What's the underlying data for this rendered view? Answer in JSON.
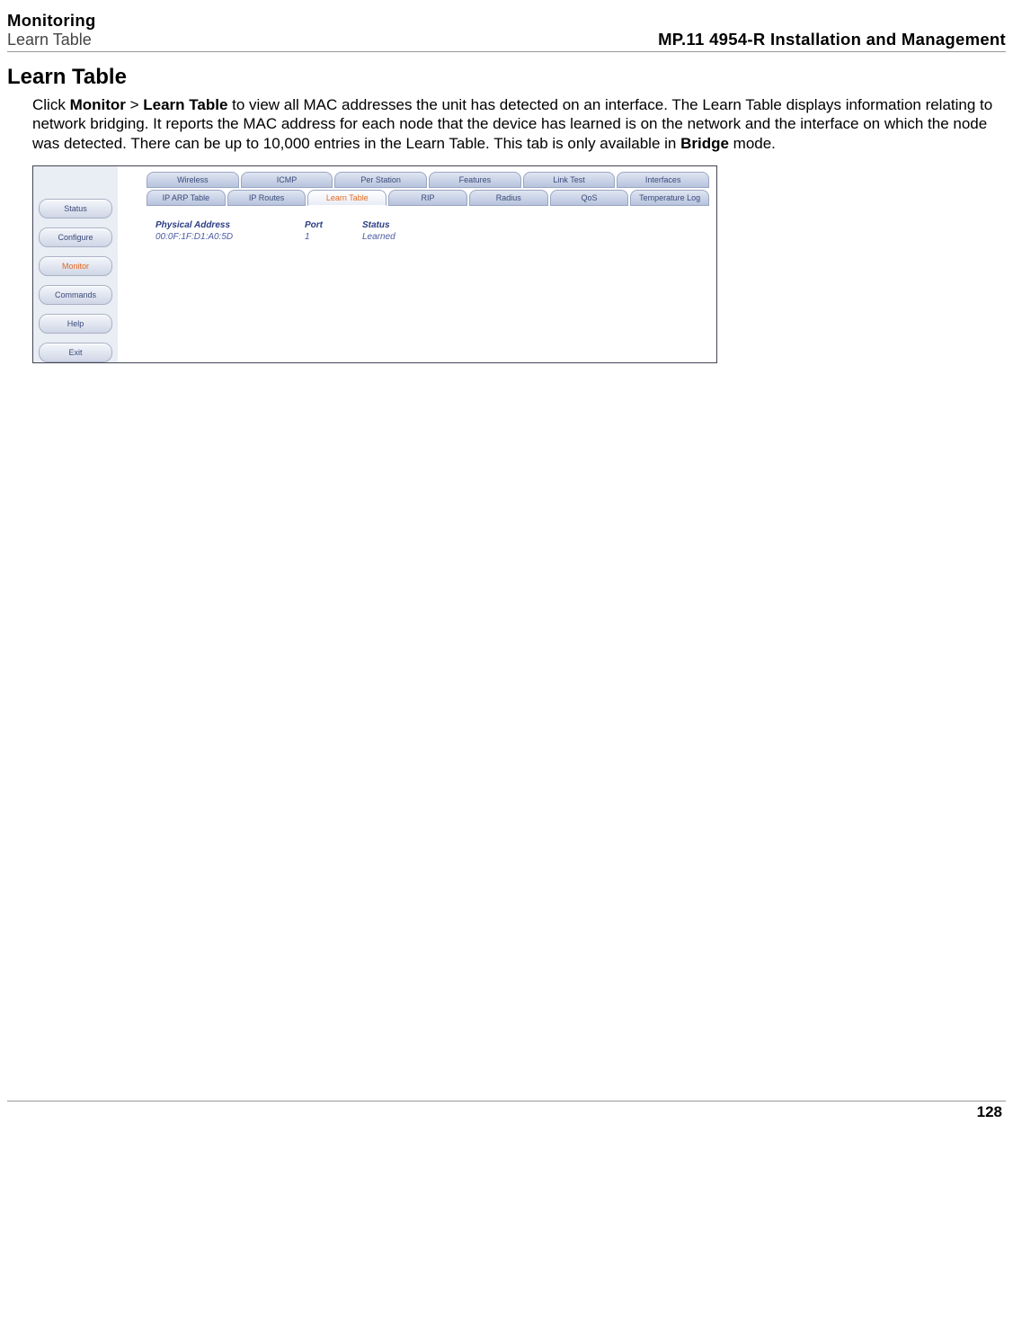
{
  "header": {
    "left_line1": "Monitoring",
    "left_line2": "Learn Table",
    "right": "MP.11 4954-R Installation and Management"
  },
  "section_title": "Learn Table",
  "body": {
    "t1": "Click ",
    "b1": "Monitor",
    "t2": " > ",
    "b2": "Learn Table",
    "t3": " to view all MAC addresses the unit has detected on an interface. The Learn Table displays information relating to network bridging. It reports the MAC address for each node that the device has learned is on the network and the interface on which the node was detected. There can be up to 10,000 entries in the Learn Table. This tab is only available in ",
    "b3": "Bridge",
    "t4": " mode."
  },
  "screenshot": {
    "sidebar": {
      "items": [
        {
          "label": "Status"
        },
        {
          "label": "Configure"
        },
        {
          "label": "Monitor"
        },
        {
          "label": "Commands"
        },
        {
          "label": "Help"
        },
        {
          "label": "Exit"
        }
      ]
    },
    "tabs_row1": [
      {
        "label": "Wireless"
      },
      {
        "label": "ICMP"
      },
      {
        "label": "Per Station"
      },
      {
        "label": "Features"
      },
      {
        "label": "Link Test"
      },
      {
        "label": "Interfaces"
      }
    ],
    "tabs_row2": [
      {
        "label": "IP ARP Table"
      },
      {
        "label": "IP Routes"
      },
      {
        "label": "Learn Table"
      },
      {
        "label": "RIP"
      },
      {
        "label": "Radius"
      },
      {
        "label": "QoS"
      },
      {
        "label": "Temperature Log"
      }
    ],
    "table": {
      "headers": {
        "addr": "Physical Address",
        "port": "Port",
        "status": "Status"
      },
      "rows": [
        {
          "addr": "00:0F:1F:D1:A0:5D",
          "port": "1",
          "status": "Learned"
        }
      ]
    }
  },
  "page_number": "128"
}
